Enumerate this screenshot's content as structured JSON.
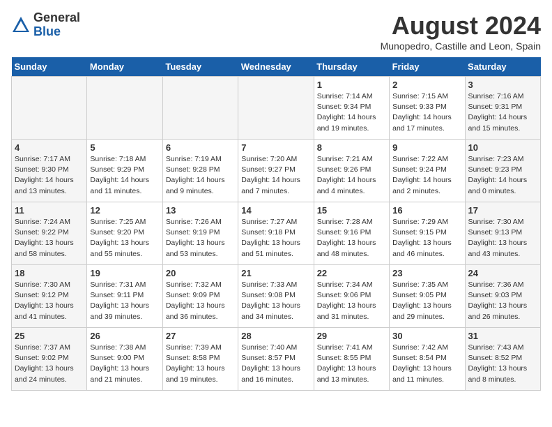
{
  "logo": {
    "general": "General",
    "blue": "Blue"
  },
  "title": "August 2024",
  "location": "Munopedro, Castille and Leon, Spain",
  "days_of_week": [
    "Sunday",
    "Monday",
    "Tuesday",
    "Wednesday",
    "Thursday",
    "Friday",
    "Saturday"
  ],
  "weeks": [
    [
      {
        "day": "",
        "info": ""
      },
      {
        "day": "",
        "info": ""
      },
      {
        "day": "",
        "info": ""
      },
      {
        "day": "",
        "info": ""
      },
      {
        "day": "1",
        "info": "Sunrise: 7:14 AM\nSunset: 9:34 PM\nDaylight: 14 hours\nand 19 minutes."
      },
      {
        "day": "2",
        "info": "Sunrise: 7:15 AM\nSunset: 9:33 PM\nDaylight: 14 hours\nand 17 minutes."
      },
      {
        "day": "3",
        "info": "Sunrise: 7:16 AM\nSunset: 9:31 PM\nDaylight: 14 hours\nand 15 minutes."
      }
    ],
    [
      {
        "day": "4",
        "info": "Sunrise: 7:17 AM\nSunset: 9:30 PM\nDaylight: 14 hours\nand 13 minutes."
      },
      {
        "day": "5",
        "info": "Sunrise: 7:18 AM\nSunset: 9:29 PM\nDaylight: 14 hours\nand 11 minutes."
      },
      {
        "day": "6",
        "info": "Sunrise: 7:19 AM\nSunset: 9:28 PM\nDaylight: 14 hours\nand 9 minutes."
      },
      {
        "day": "7",
        "info": "Sunrise: 7:20 AM\nSunset: 9:27 PM\nDaylight: 14 hours\nand 7 minutes."
      },
      {
        "day": "8",
        "info": "Sunrise: 7:21 AM\nSunset: 9:26 PM\nDaylight: 14 hours\nand 4 minutes."
      },
      {
        "day": "9",
        "info": "Sunrise: 7:22 AM\nSunset: 9:24 PM\nDaylight: 14 hours\nand 2 minutes."
      },
      {
        "day": "10",
        "info": "Sunrise: 7:23 AM\nSunset: 9:23 PM\nDaylight: 14 hours\nand 0 minutes."
      }
    ],
    [
      {
        "day": "11",
        "info": "Sunrise: 7:24 AM\nSunset: 9:22 PM\nDaylight: 13 hours\nand 58 minutes."
      },
      {
        "day": "12",
        "info": "Sunrise: 7:25 AM\nSunset: 9:20 PM\nDaylight: 13 hours\nand 55 minutes."
      },
      {
        "day": "13",
        "info": "Sunrise: 7:26 AM\nSunset: 9:19 PM\nDaylight: 13 hours\nand 53 minutes."
      },
      {
        "day": "14",
        "info": "Sunrise: 7:27 AM\nSunset: 9:18 PM\nDaylight: 13 hours\nand 51 minutes."
      },
      {
        "day": "15",
        "info": "Sunrise: 7:28 AM\nSunset: 9:16 PM\nDaylight: 13 hours\nand 48 minutes."
      },
      {
        "day": "16",
        "info": "Sunrise: 7:29 AM\nSunset: 9:15 PM\nDaylight: 13 hours\nand 46 minutes."
      },
      {
        "day": "17",
        "info": "Sunrise: 7:30 AM\nSunset: 9:13 PM\nDaylight: 13 hours\nand 43 minutes."
      }
    ],
    [
      {
        "day": "18",
        "info": "Sunrise: 7:30 AM\nSunset: 9:12 PM\nDaylight: 13 hours\nand 41 minutes."
      },
      {
        "day": "19",
        "info": "Sunrise: 7:31 AM\nSunset: 9:11 PM\nDaylight: 13 hours\nand 39 minutes."
      },
      {
        "day": "20",
        "info": "Sunrise: 7:32 AM\nSunset: 9:09 PM\nDaylight: 13 hours\nand 36 minutes."
      },
      {
        "day": "21",
        "info": "Sunrise: 7:33 AM\nSunset: 9:08 PM\nDaylight: 13 hours\nand 34 minutes."
      },
      {
        "day": "22",
        "info": "Sunrise: 7:34 AM\nSunset: 9:06 PM\nDaylight: 13 hours\nand 31 minutes."
      },
      {
        "day": "23",
        "info": "Sunrise: 7:35 AM\nSunset: 9:05 PM\nDaylight: 13 hours\nand 29 minutes."
      },
      {
        "day": "24",
        "info": "Sunrise: 7:36 AM\nSunset: 9:03 PM\nDaylight: 13 hours\nand 26 minutes."
      }
    ],
    [
      {
        "day": "25",
        "info": "Sunrise: 7:37 AM\nSunset: 9:02 PM\nDaylight: 13 hours\nand 24 minutes."
      },
      {
        "day": "26",
        "info": "Sunrise: 7:38 AM\nSunset: 9:00 PM\nDaylight: 13 hours\nand 21 minutes."
      },
      {
        "day": "27",
        "info": "Sunrise: 7:39 AM\nSunset: 8:58 PM\nDaylight: 13 hours\nand 19 minutes."
      },
      {
        "day": "28",
        "info": "Sunrise: 7:40 AM\nSunset: 8:57 PM\nDaylight: 13 hours\nand 16 minutes."
      },
      {
        "day": "29",
        "info": "Sunrise: 7:41 AM\nSunset: 8:55 PM\nDaylight: 13 hours\nand 13 minutes."
      },
      {
        "day": "30",
        "info": "Sunrise: 7:42 AM\nSunset: 8:54 PM\nDaylight: 13 hours\nand 11 minutes."
      },
      {
        "day": "31",
        "info": "Sunrise: 7:43 AM\nSunset: 8:52 PM\nDaylight: 13 hours\nand 8 minutes."
      }
    ]
  ]
}
